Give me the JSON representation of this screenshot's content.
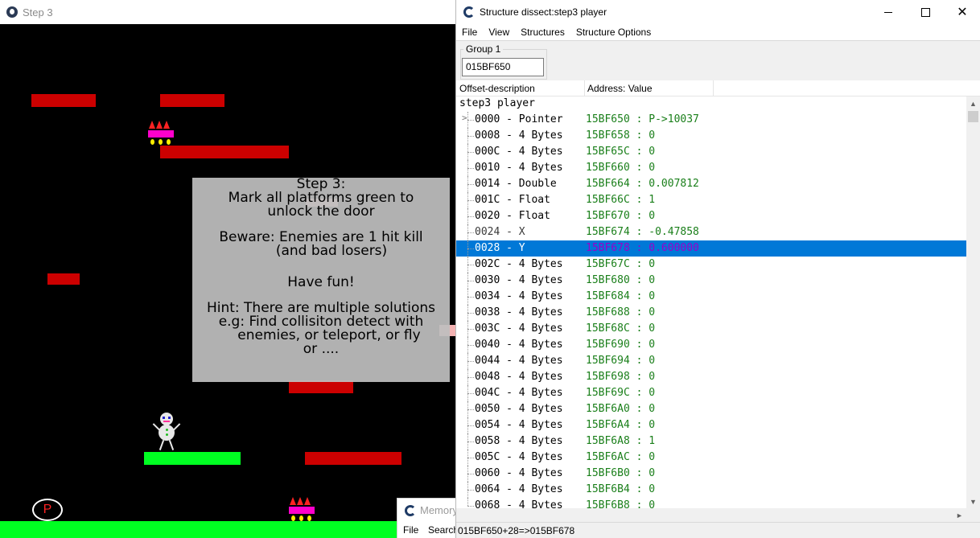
{
  "game_window": {
    "title": "Step 3",
    "message_lines": [
      "Step 3:",
      "Mark all platforms green to",
      "unlock the door",
      "",
      "Beware: Enemies are 1 hit kill",
      "(and bad losers)",
      "",
      "Have fun!",
      "",
      "Hint: There are multiple solutions",
      "e.g: Find collisiton detect with",
      "enemies, or teleport, or fly",
      "or ...."
    ],
    "p_badge": "P",
    "colors": {
      "background": "#000000",
      "platform_unmarked": "#cc0000",
      "platform_marked": "#00ff22",
      "enemy_body": "#ff00cc"
    }
  },
  "memory_viewer": {
    "title": "Memory",
    "menu": [
      "File",
      "Search"
    ]
  },
  "structure_window": {
    "title": "Structure dissect:step3 player",
    "menu": [
      "File",
      "View",
      "Structures",
      "Structure Options"
    ],
    "group_label": "Group 1",
    "address_input": "015BF650",
    "columns": [
      "Offset-description",
      "Address: Value"
    ],
    "root_label": "step3 player",
    "rows": [
      {
        "offset": "0000 - Pointer",
        "value": "15BF650 : P->10037",
        "expander": ">"
      },
      {
        "offset": "0008 - 4 Bytes",
        "value": "15BF658 : 0"
      },
      {
        "offset": "000C - 4 Bytes",
        "value": "15BF65C : 0"
      },
      {
        "offset": "0010 - 4 Bytes",
        "value": "15BF660 : 0"
      },
      {
        "offset": "0014 - Double",
        "value": "15BF664 : 0.007812"
      },
      {
        "offset": "001C - Float",
        "value": "15BF66C : 1"
      },
      {
        "offset": "0020 - Float",
        "value": "15BF670 : 0"
      },
      {
        "offset": "0024 - X",
        "value": "15BF674 : -0.47858",
        "named": true
      },
      {
        "offset": "0028 - Y",
        "value": "15BF678 : 0.600000",
        "named": true,
        "selected": true
      },
      {
        "offset": "002C - 4 Bytes",
        "value": "15BF67C : 0"
      },
      {
        "offset": "0030 - 4 Bytes",
        "value": "15BF680 : 0"
      },
      {
        "offset": "0034 - 4 Bytes",
        "value": "15BF684 : 0"
      },
      {
        "offset": "0038 - 4 Bytes",
        "value": "15BF688 : 0"
      },
      {
        "offset": "003C - 4 Bytes",
        "value": "15BF68C : 0"
      },
      {
        "offset": "0040 - 4 Bytes",
        "value": "15BF690 : 0"
      },
      {
        "offset": "0044 - 4 Bytes",
        "value": "15BF694 : 0"
      },
      {
        "offset": "0048 - 4 Bytes",
        "value": "15BF698 : 0"
      },
      {
        "offset": "004C - 4 Bytes",
        "value": "15BF69C : 0"
      },
      {
        "offset": "0050 - 4 Bytes",
        "value": "15BF6A0 : 0"
      },
      {
        "offset": "0054 - 4 Bytes",
        "value": "15BF6A4 : 0"
      },
      {
        "offset": "0058 - 4 Bytes",
        "value": "15BF6A8 : 1"
      },
      {
        "offset": "005C - 4 Bytes",
        "value": "15BF6AC : 0"
      },
      {
        "offset": "0060 - 4 Bytes",
        "value": "15BF6B0 : 0"
      },
      {
        "offset": "0064 - 4 Bytes",
        "value": "15BF6B4 : 0"
      },
      {
        "offset": "0068 - 4 Bytes",
        "value": "15BF6B8 : 0"
      }
    ],
    "status": "015BF650+28=>015BF678",
    "colors": {
      "value_text": "#1a7f1a",
      "selection": "#0078d7",
      "selected_value_text": "#9b00c9"
    }
  }
}
